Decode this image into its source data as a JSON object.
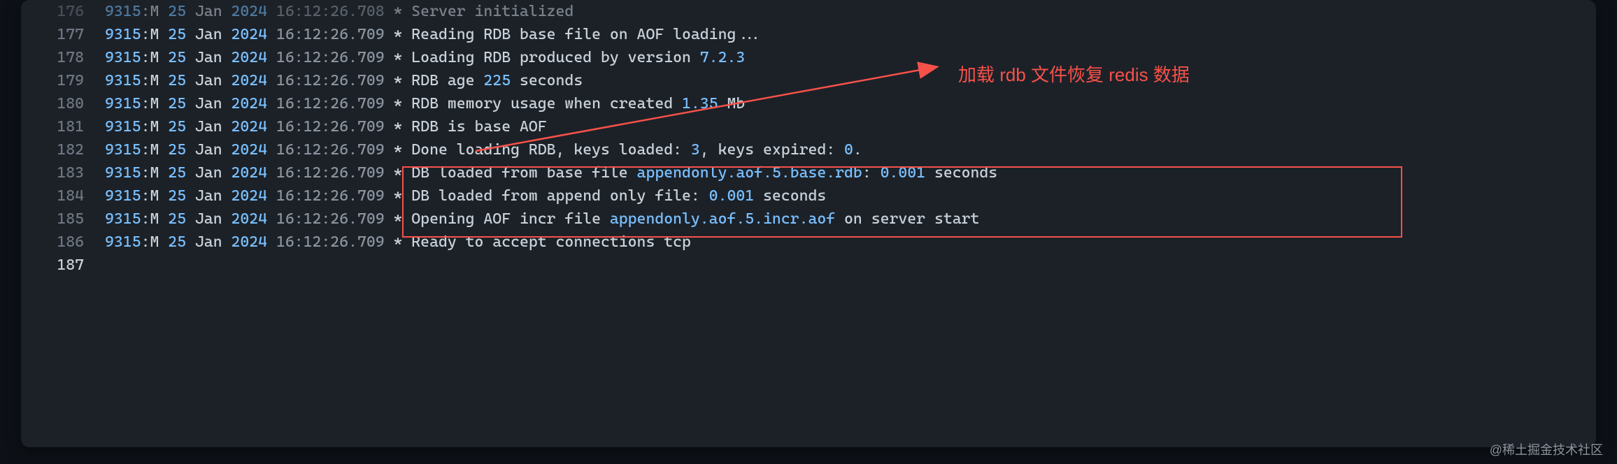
{
  "annotation_text": "加载 rdb 文件恢复 redis 数据",
  "watermark": "@稀土掘金技术社区",
  "lines": [
    {
      "num": "176",
      "pid": "9315",
      "m": "M",
      "day": "25",
      "month": "Jan",
      "year": "2024",
      "time": "16:12:26.708",
      "star": "*",
      "tokens": [
        {
          "t": "text",
          "v": " Server initialized"
        }
      ],
      "dim": true
    },
    {
      "num": "177",
      "pid": "9315",
      "m": "M",
      "day": "25",
      "month": "Jan",
      "year": "2024",
      "time": "16:12:26.709",
      "star": "*",
      "tokens": [
        {
          "t": "text",
          "v": " Reading RDB base file on AOF loading..."
        }
      ]
    },
    {
      "num": "178",
      "pid": "9315",
      "m": "M",
      "day": "25",
      "month": "Jan",
      "year": "2024",
      "time": "16:12:26.709",
      "star": "*",
      "tokens": [
        {
          "t": "text",
          "v": " Loading RDB produced by version "
        },
        {
          "t": "num",
          "v": "7.2.3"
        }
      ]
    },
    {
      "num": "179",
      "pid": "9315",
      "m": "M",
      "day": "25",
      "month": "Jan",
      "year": "2024",
      "time": "16:12:26.709",
      "star": "*",
      "tokens": [
        {
          "t": "text",
          "v": " RDB age "
        },
        {
          "t": "num",
          "v": "225"
        },
        {
          "t": "text",
          "v": " seconds"
        }
      ]
    },
    {
      "num": "180",
      "pid": "9315",
      "m": "M",
      "day": "25",
      "month": "Jan",
      "year": "2024",
      "time": "16:12:26.709",
      "star": "*",
      "tokens": [
        {
          "t": "text",
          "v": " RDB memory usage when created "
        },
        {
          "t": "num",
          "v": "1.35"
        },
        {
          "t": "text",
          "v": " Mb"
        }
      ]
    },
    {
      "num": "181",
      "pid": "9315",
      "m": "M",
      "day": "25",
      "month": "Jan",
      "year": "2024",
      "time": "16:12:26.709",
      "star": "*",
      "tokens": [
        {
          "t": "text",
          "v": " RDB is base AOF"
        }
      ]
    },
    {
      "num": "182",
      "pid": "9315",
      "m": "M",
      "day": "25",
      "month": "Jan",
      "year": "2024",
      "time": "16:12:26.709",
      "star": "*",
      "tokens": [
        {
          "t": "text",
          "v": " Done loading RDB, keys loaded: "
        },
        {
          "t": "num",
          "v": "3"
        },
        {
          "t": "text",
          "v": ", keys expired: "
        },
        {
          "t": "num",
          "v": "0"
        },
        {
          "t": "text",
          "v": "."
        }
      ]
    },
    {
      "num": "183",
      "pid": "9315",
      "m": "M",
      "day": "25",
      "month": "Jan",
      "year": "2024",
      "time": "16:12:26.709",
      "star": "*",
      "tokens": [
        {
          "t": "text",
          "v": " DB loaded from base file "
        },
        {
          "t": "file",
          "v": "appendonly.aof.5.base.rdb"
        },
        {
          "t": "text",
          "v": ": "
        },
        {
          "t": "num",
          "v": "0.001"
        },
        {
          "t": "text",
          "v": " seconds"
        }
      ]
    },
    {
      "num": "184",
      "pid": "9315",
      "m": "M",
      "day": "25",
      "month": "Jan",
      "year": "2024",
      "time": "16:12:26.709",
      "star": "*",
      "tokens": [
        {
          "t": "text",
          "v": " DB loaded from append only file: "
        },
        {
          "t": "num",
          "v": "0.001"
        },
        {
          "t": "text",
          "v": " seconds"
        }
      ]
    },
    {
      "num": "185",
      "pid": "9315",
      "m": "M",
      "day": "25",
      "month": "Jan",
      "year": "2024",
      "time": "16:12:26.709",
      "star": "*",
      "tokens": [
        {
          "t": "text",
          "v": " Opening AOF incr file "
        },
        {
          "t": "file",
          "v": "appendonly.aof.5.incr.aof"
        },
        {
          "t": "text",
          "v": " on server start"
        }
      ]
    },
    {
      "num": "186",
      "pid": "9315",
      "m": "M",
      "day": "25",
      "month": "Jan",
      "year": "2024",
      "time": "16:12:26.709",
      "star": "*",
      "tokens": [
        {
          "t": "text",
          "v": " Ready to accept connections tcp"
        }
      ]
    },
    {
      "num": "187",
      "empty": true
    }
  ]
}
